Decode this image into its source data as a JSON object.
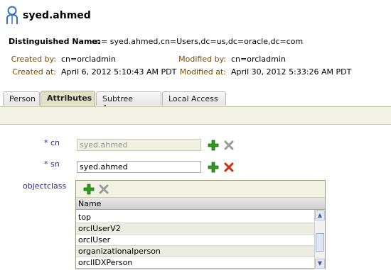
{
  "header": {
    "title": "syed.ahmed",
    "dn_label": "Distinguished Name:",
    "dn_value": "cn= syed.ahmed,cn=Users,dc=us,dc=oracle,dc=com",
    "created_by_label": "Created by:",
    "created_by_value": "cn=orcladmin",
    "created_at_label": "Created at:",
    "created_at_value": "April 6, 2012 5:10:43 AM PDT",
    "modified_by_label": "Modified by:",
    "modified_by_value": "cn=orcladmin",
    "modified_at_label": "Modified at:",
    "modified_at_value": "April 30, 2012 5:33:26 AM PDT"
  },
  "tabs": [
    {
      "label": "Person",
      "active": false
    },
    {
      "label": "Attributes",
      "active": true
    },
    {
      "label": "Subtree Access",
      "active": false
    },
    {
      "label": "Local Access",
      "active": false
    }
  ],
  "form": {
    "required_mark": "*",
    "cn_label": "cn",
    "cn_value": "syed.ahmed",
    "sn_label": "sn",
    "sn_value": "syed.ahmed",
    "objectclass_label": "objectclass"
  },
  "objectclass_table": {
    "column_header": "Name",
    "rows": [
      "top",
      "orclUserV2",
      "orclUser",
      "organizationalperson",
      "orclIDXPerson"
    ]
  },
  "colors": {
    "add": "#2e9a1e",
    "delete_active": "#d42a10",
    "delete_disabled": "#9a9a9a"
  }
}
